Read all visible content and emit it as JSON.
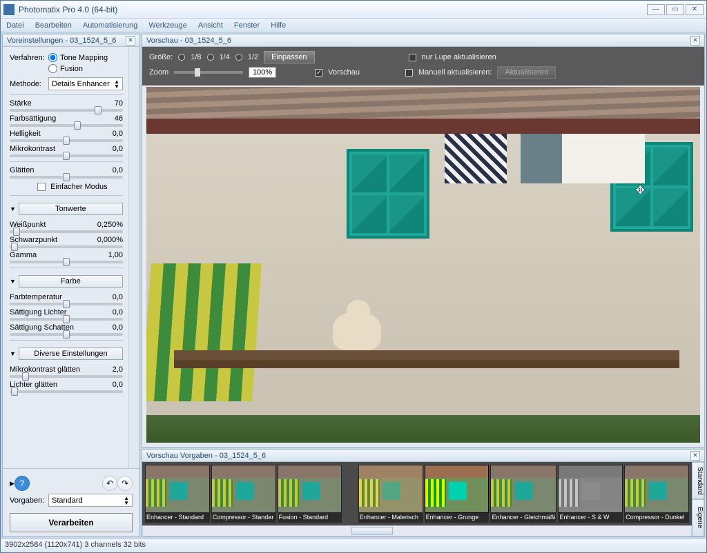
{
  "app": {
    "title": "Photomatix Pro 4.0 (64-bit)"
  },
  "menu": [
    "Datei",
    "Bearbeiten",
    "Automatisierung",
    "Werkzeuge",
    "Ansicht",
    "Fenster",
    "Hilfe"
  ],
  "leftPanel": {
    "title": "Voreinstellungen - 03_1524_5_6",
    "verfahrenLabel": "Verfahren:",
    "toneMapping": "Tone Mapping",
    "fusion": "Fusion",
    "methodeLabel": "Methode:",
    "methode": "Details Enhancer",
    "sliders1": [
      {
        "label": "Stärke",
        "value": "70",
        "pos": 78
      },
      {
        "label": "Farbsättigung",
        "value": "46",
        "pos": 60
      },
      {
        "label": "Helligkeit",
        "value": "0,0",
        "pos": 50
      },
      {
        "label": "Mikrokontrast",
        "value": "0,0",
        "pos": 50
      }
    ],
    "glatten": {
      "label": "Glätten",
      "value": "0,0",
      "pos": 50
    },
    "einfacher": "Einfacher Modus",
    "section1": "Tonwerte",
    "sliders2": [
      {
        "label": "Weißpunkt",
        "value": "0,250%",
        "pos": 6
      },
      {
        "label": "Schwarzpunkt",
        "value": "0,000%",
        "pos": 4
      },
      {
        "label": "Gamma",
        "value": "1,00",
        "pos": 50
      }
    ],
    "section2": "Farbe",
    "sliders3": [
      {
        "label": "Farbtemperatur",
        "value": "0,0",
        "pos": 50
      },
      {
        "label": "Sättigung Lichter",
        "value": "0,0",
        "pos": 50
      },
      {
        "label": "Sättigung Schatten",
        "value": "0,0",
        "pos": 50
      }
    ],
    "section3": "Diverse Einstellungen",
    "sliders4": [
      {
        "label": "Mikrokontrast glätten",
        "value": "2,0",
        "pos": 14
      },
      {
        "label": "Lichter glätten",
        "value": "0,0",
        "pos": 4
      }
    ],
    "vorgabenLabel": "Vorgaben:",
    "vorgaben": "Standard",
    "process": "Verarbeiten"
  },
  "previewPanel": {
    "title": "Vorschau - 03_1524_5_6",
    "sizeLabel": "Größe:",
    "sizes": [
      "1/8",
      "1/4",
      "1/2"
    ],
    "einpassen": "Einpassen",
    "zoomLabel": "Zoom",
    "zoomValue": "100%",
    "vorschauCb": "Vorschau",
    "lupeCb": "nur Lupe aktualisieren",
    "manuellCb": "Manuell aktualisieren:",
    "aktualisieren": "Aktualisieren"
  },
  "presetsPanel": {
    "title": "Vorschau Vorgaben - 03_1524_5_6",
    "items": [
      "Enhancer - Standard",
      "Compressor - Standar",
      "Fusion - Standard",
      "Enhancer - Malerisch",
      "Enhancer - Grunge",
      "Enhancer - Gleichmäßi",
      "Enhancer - S & W",
      "Compressor - Dunkel"
    ],
    "tabs": [
      "Standard",
      "Eigene"
    ]
  },
  "status": "3902x2584 (1120x741) 3 channels 32 bits"
}
